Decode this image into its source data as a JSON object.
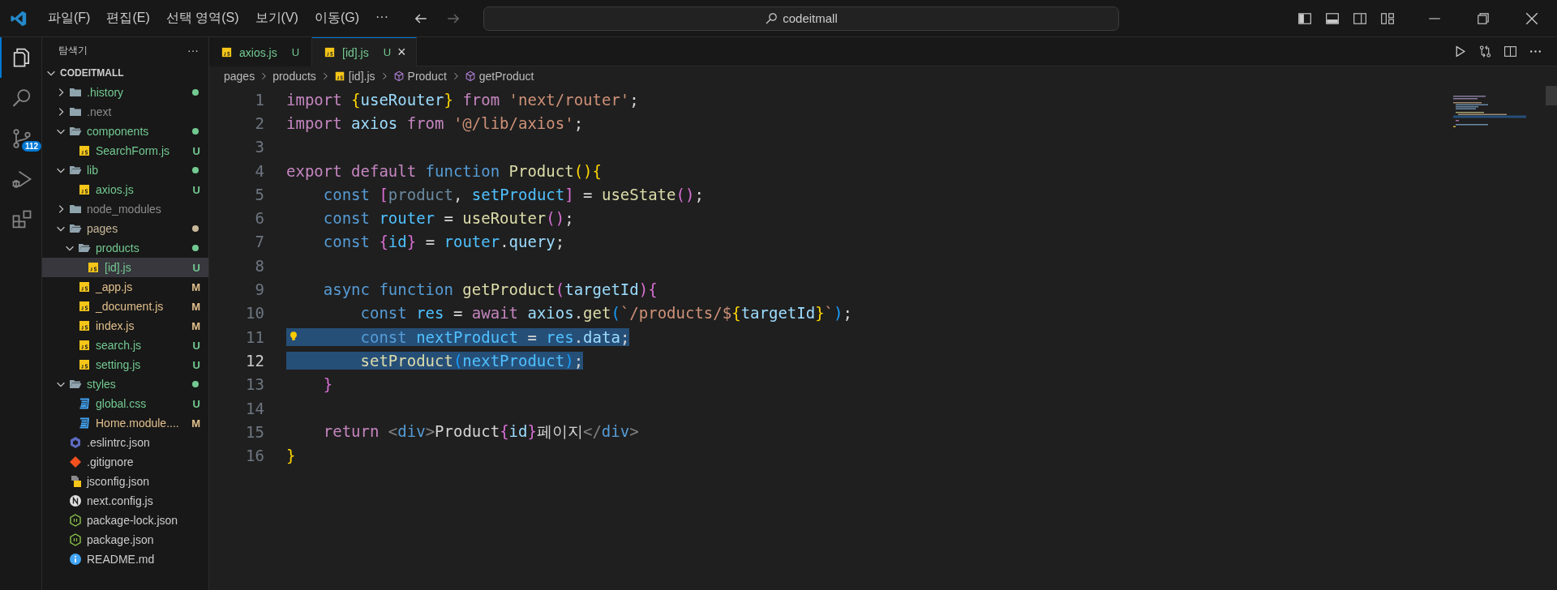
{
  "title_bar": {
    "menus": [
      "파일(F)",
      "편집(E)",
      "선택 영역(S)",
      "보기(V)",
      "이동(G)"
    ],
    "more": "···",
    "search": "codeitmall"
  },
  "activity_bar": [
    {
      "kind": "explorer",
      "selected": true
    },
    {
      "kind": "search",
      "selected": false
    },
    {
      "kind": "source-control",
      "selected": false,
      "badge": "112"
    },
    {
      "kind": "run",
      "selected": false
    },
    {
      "kind": "extensions",
      "selected": false
    }
  ],
  "explorer": {
    "title": "탐색기",
    "more": "···",
    "root": "CODEITMALL",
    "expanded": true,
    "tree": [
      {
        "name": ".history",
        "kind": "folder",
        "color": "#73c991",
        "dot": true,
        "expanded": false,
        "selected": false
      },
      {
        "name": ".next",
        "kind": "folder",
        "color": "#8c8c8c",
        "dot": false,
        "expanded": false,
        "selected": false
      },
      {
        "name": "components",
        "kind": "folder",
        "color": "#73c991",
        "dot": true,
        "expanded": true,
        "selected": false,
        "children": [
          {
            "name": "SearchForm.js",
            "kind": "js",
            "color": "#73c991",
            "badge": "U",
            "selected": false
          }
        ]
      },
      {
        "name": "lib",
        "kind": "folder",
        "color": "#73c991",
        "dot": true,
        "expanded": true,
        "selected": false,
        "children": [
          {
            "name": "axios.js",
            "kind": "js",
            "color": "#73c991",
            "badge": "U",
            "selected": false
          }
        ]
      },
      {
        "name": "node_modules",
        "kind": "folder",
        "color": "#8c8c8c",
        "dot": false,
        "expanded": false,
        "selected": false
      },
      {
        "name": "pages",
        "kind": "folder",
        "color": "#c8b89a",
        "dot": true,
        "expanded": true,
        "selected": false,
        "children": [
          {
            "name": "products",
            "kind": "folder",
            "color": "#73c991",
            "dot": true,
            "expanded": true,
            "selected": false,
            "children": [
              {
                "name": "[id].js",
                "kind": "js",
                "color": "#73c991",
                "badge": "U",
                "selected": true
              }
            ]
          },
          {
            "name": "_app.js",
            "kind": "js",
            "color": "#e2c08d",
            "badge": "M",
            "selected": false
          },
          {
            "name": "_document.js",
            "kind": "js",
            "color": "#e2c08d",
            "badge": "M",
            "selected": false
          },
          {
            "name": "index.js",
            "kind": "js",
            "color": "#e2c08d",
            "badge": "M",
            "selected": false
          },
          {
            "name": "search.js",
            "kind": "js",
            "color": "#73c991",
            "badge": "U",
            "selected": false
          },
          {
            "name": "setting.js",
            "kind": "js",
            "color": "#73c991",
            "badge": "U",
            "selected": false
          }
        ]
      },
      {
        "name": "styles",
        "kind": "folder",
        "color": "#73c991",
        "dot": true,
        "expanded": true,
        "selected": false,
        "children": [
          {
            "name": "global.css",
            "kind": "css",
            "color": "#73c991",
            "badge": "U",
            "selected": false
          },
          {
            "name": "Home.module....",
            "kind": "css",
            "color": "#e2c08d",
            "badge": "M",
            "selected": false
          }
        ]
      },
      {
        "name": ".eslintrc.json",
        "kind": "eslint",
        "color": "#cccccc",
        "selected": false
      },
      {
        "name": ".gitignore",
        "kind": "git",
        "color": "#cccccc",
        "selected": false
      },
      {
        "name": "jsconfig.json",
        "kind": "jsconfig",
        "color": "#cccccc",
        "selected": false
      },
      {
        "name": "next.config.js",
        "kind": "next",
        "color": "#cccccc",
        "selected": false
      },
      {
        "name": "package-lock.json",
        "kind": "node",
        "color": "#cccccc",
        "selected": false
      },
      {
        "name": "package.json",
        "kind": "node",
        "color": "#cccccc",
        "selected": false
      },
      {
        "name": "README.md",
        "kind": "info",
        "color": "#cccccc",
        "selected": false
      }
    ]
  },
  "tabs": [
    {
      "label": "axios.js",
      "badge": "U",
      "color": "#73c991",
      "selected": false
    },
    {
      "label": "[id].js",
      "badge": "U",
      "color": "#73c991",
      "selected": true,
      "close": "×"
    }
  ],
  "breadcrumb": [
    {
      "label": "pages",
      "kind": "folder"
    },
    {
      "label": "products",
      "kind": "folder"
    },
    {
      "label": "[id].js",
      "kind": "js"
    },
    {
      "label": "Product",
      "kind": "symbol"
    },
    {
      "label": "getProduct",
      "kind": "symbol"
    }
  ],
  "editor": {
    "lines": [
      {
        "number": "1",
        "current": false,
        "selected": false,
        "tokens": [
          {
            "kind": "kw",
            "text": "import "
          },
          {
            "kind": "b1",
            "text": "{"
          },
          {
            "kind": "var",
            "text": "useRouter"
          },
          {
            "kind": "b1",
            "text": "} "
          },
          {
            "kind": "kw",
            "text": "from "
          },
          {
            "kind": "str",
            "text": "'next/router'"
          },
          {
            "kind": "text",
            "text": ";"
          }
        ]
      },
      {
        "number": "2",
        "current": false,
        "selected": false,
        "tokens": [
          {
            "kind": "kw",
            "text": "import "
          },
          {
            "kind": "var",
            "text": "axios "
          },
          {
            "kind": "kw",
            "text": "from "
          },
          {
            "kind": "str",
            "text": "'@/lib/axios'"
          },
          {
            "kind": "text",
            "text": ";"
          }
        ]
      },
      {
        "number": "3",
        "current": false,
        "selected": false
      },
      {
        "number": "4",
        "current": false,
        "selected": false,
        "tokens": [
          {
            "kind": "kw",
            "text": "export default "
          },
          {
            "kind": "store",
            "text": "function "
          },
          {
            "kind": "fn",
            "text": "Product"
          },
          {
            "kind": "b1",
            "text": "(){"
          }
        ]
      },
      {
        "number": "5",
        "current": false,
        "selected": false,
        "tokens": [
          {
            "kind": "store",
            "text": "    const "
          },
          {
            "kind": "b2",
            "text": "["
          },
          {
            "kind": "faded",
            "text": "product"
          },
          {
            "kind": "text",
            "text": ", "
          },
          {
            "kind": "const",
            "text": "setProduct"
          },
          {
            "kind": "b2",
            "text": "]"
          },
          {
            "kind": "text",
            "text": " = "
          },
          {
            "kind": "fn",
            "text": "useState"
          },
          {
            "kind": "b2",
            "text": "()"
          },
          {
            "kind": "text",
            "text": ";"
          }
        ]
      },
      {
        "number": "6",
        "current": false,
        "selected": false,
        "tokens": [
          {
            "kind": "store",
            "text": "    const "
          },
          {
            "kind": "const",
            "text": "router"
          },
          {
            "kind": "text",
            "text": " = "
          },
          {
            "kind": "fn",
            "text": "useRouter"
          },
          {
            "kind": "b2",
            "text": "()"
          },
          {
            "kind": "text",
            "text": ";"
          }
        ]
      },
      {
        "number": "7",
        "current": false,
        "selected": false,
        "tokens": [
          {
            "kind": "store",
            "text": "    const "
          },
          {
            "kind": "b2",
            "text": "{"
          },
          {
            "kind": "const",
            "text": "id"
          },
          {
            "kind": "b2",
            "text": "}"
          },
          {
            "kind": "text",
            "text": " = "
          },
          {
            "kind": "const",
            "text": "router"
          },
          {
            "kind": "text",
            "text": "."
          },
          {
            "kind": "var",
            "text": "query"
          },
          {
            "kind": "text",
            "text": ";"
          }
        ]
      },
      {
        "number": "8",
        "current": false,
        "selected": false
      },
      {
        "number": "9",
        "current": false,
        "selected": false,
        "tokens": [
          {
            "kind": "store",
            "text": "    async function "
          },
          {
            "kind": "fn",
            "text": "getProduct"
          },
          {
            "kind": "b2",
            "text": "("
          },
          {
            "kind": "var",
            "text": "targetId"
          },
          {
            "kind": "b2",
            "text": "){"
          }
        ]
      },
      {
        "number": "10",
        "current": false,
        "selected": false,
        "tokens": [
          {
            "kind": "store",
            "text": "        const "
          },
          {
            "kind": "const",
            "text": "res"
          },
          {
            "kind": "text",
            "text": " = "
          },
          {
            "kind": "kw",
            "text": "await "
          },
          {
            "kind": "var",
            "text": "axios"
          },
          {
            "kind": "text",
            "text": "."
          },
          {
            "kind": "fn",
            "text": "get"
          },
          {
            "kind": "b3",
            "text": "("
          },
          {
            "kind": "str",
            "text": "`/products/$"
          },
          {
            "kind": "b1",
            "text": "{"
          },
          {
            "kind": "var",
            "text": "targetId"
          },
          {
            "kind": "b1",
            "text": "}"
          },
          {
            "kind": "str",
            "text": "`"
          },
          {
            "kind": "b3",
            "text": ")"
          },
          {
            "kind": "text",
            "text": ";"
          }
        ]
      },
      {
        "number": "11",
        "current": false,
        "selected": true,
        "bulb": true,
        "tokens": [
          {
            "kind": "store",
            "text": "        const "
          },
          {
            "kind": "const",
            "text": "nextProduct"
          },
          {
            "kind": "text",
            "text": " = "
          },
          {
            "kind": "const",
            "text": "res"
          },
          {
            "kind": "text",
            "text": "."
          },
          {
            "kind": "var",
            "text": "data"
          },
          {
            "kind": "text",
            "text": ";"
          }
        ]
      },
      {
        "number": "12",
        "current": true,
        "selected": true,
        "tokens": [
          {
            "kind": "fn",
            "text": "        setProduct"
          },
          {
            "kind": "b3",
            "text": "("
          },
          {
            "kind": "const",
            "text": "nextProduct"
          },
          {
            "kind": "b3",
            "text": ")"
          },
          {
            "kind": "text",
            "text": ";"
          }
        ]
      },
      {
        "number": "13",
        "current": false,
        "selected": false,
        "tokens": [
          {
            "kind": "b2",
            "text": "    }"
          }
        ]
      },
      {
        "number": "14",
        "current": false,
        "selected": false
      },
      {
        "number": "15",
        "current": false,
        "selected": false,
        "tokens": [
          {
            "kind": "kw",
            "text": "    return "
          },
          {
            "kind": "tag",
            "text": "<"
          },
          {
            "kind": "tagname",
            "text": "div"
          },
          {
            "kind": "tag",
            "text": ">"
          },
          {
            "kind": "text",
            "text": "Product"
          },
          {
            "kind": "b2",
            "text": "{"
          },
          {
            "kind": "var",
            "text": "id"
          },
          {
            "kind": "b2",
            "text": "}"
          },
          {
            "kind": "text",
            "text": "페이지"
          },
          {
            "kind": "tag",
            "text": "</"
          },
          {
            "kind": "tagname",
            "text": "div"
          },
          {
            "kind": "tag",
            "text": ">"
          }
        ]
      },
      {
        "number": "16",
        "current": false,
        "selected": false,
        "tokens": [
          {
            "kind": "b1",
            "text": "}"
          }
        ]
      }
    ]
  }
}
